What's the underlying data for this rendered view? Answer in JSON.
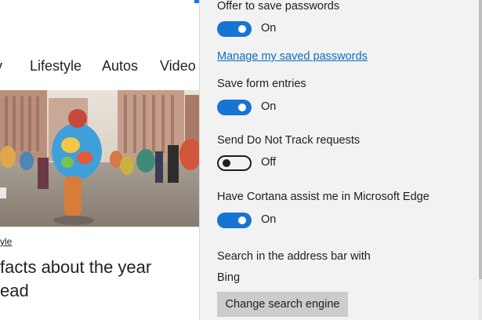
{
  "webpage": {
    "nav_items": [
      "y",
      "Lifestyle",
      "Autos",
      "Video"
    ],
    "category": "yle",
    "headline_lines": [
      "facts about the year",
      "ead"
    ]
  },
  "settings": {
    "save_passwords": {
      "label": "Offer to save passwords",
      "state": "On",
      "on": true
    },
    "manage_passwords_link": "Manage my saved passwords",
    "save_form_entries": {
      "label": "Save form entries",
      "state": "On",
      "on": true
    },
    "do_not_track": {
      "label": "Send Do Not Track requests",
      "state": "Off",
      "on": false
    },
    "cortana": {
      "label": "Have Cortana assist me in Microsoft Edge",
      "state": "On",
      "on": true
    },
    "search_engine": {
      "label": "Search in the address bar with",
      "value": "Bing",
      "change_button": "Change search engine"
    }
  },
  "colors": {
    "toggle_on": "#1774d4",
    "link": "#0f6cbd",
    "panel_bg": "#f2f2f2",
    "button_bg": "#cccccc"
  }
}
